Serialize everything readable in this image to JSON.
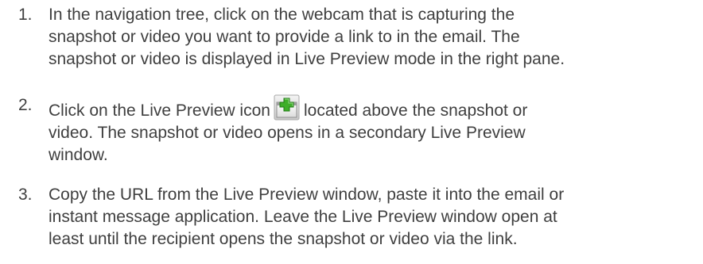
{
  "steps": [
    {
      "number": "1.",
      "lines": [
        "In the navigation tree, click on the webcam that is capturing the",
        "snapshot or video you want to provide a link to in the email. The",
        "snapshot or video is displayed in Live Preview mode in the right pane."
      ]
    },
    {
      "number": "2.",
      "lines": [
        "Click on the Live Preview icon",
        "located above the snapshot or",
        "video. The snapshot or video opens in a secondary Live Preview",
        "window."
      ],
      "icon": "live-preview-icon"
    },
    {
      "number": "3.",
      "lines": [
        "Copy the URL from the Live Preview window, paste it into the email or",
        "instant message application. Leave the Live Preview window open at",
        "least until the recipient opens the snapshot or video via the link."
      ]
    }
  ],
  "colors": {
    "text": "#3f3f3f",
    "icon_plus": "#3fae2a",
    "icon_frame": "#9a9a9a"
  }
}
